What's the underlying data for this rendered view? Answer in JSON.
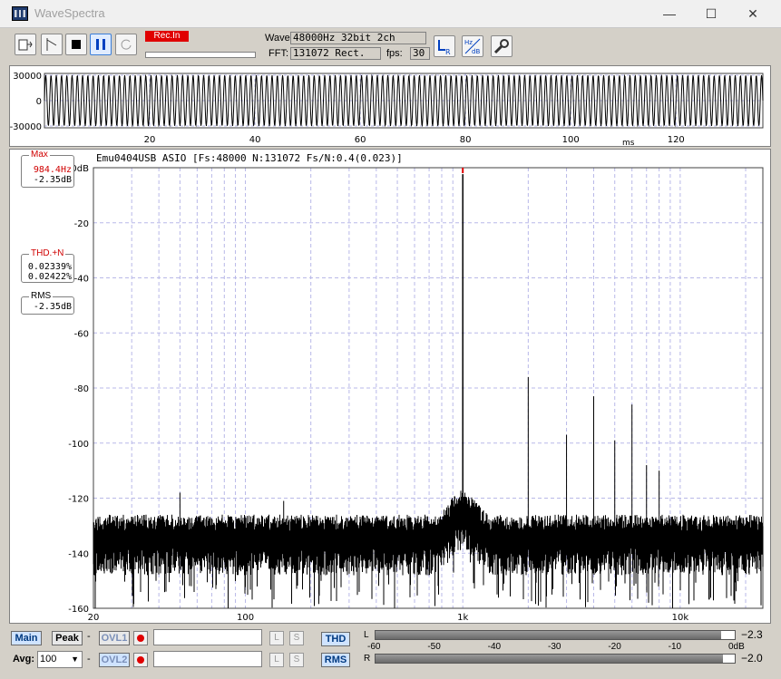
{
  "window": {
    "title": "WaveSpectra",
    "minimize": "—",
    "maximize": "☐",
    "close": "✕"
  },
  "toolbar": {
    "rec_label": "Rec.In",
    "wave_label": "Wave:",
    "wave_value": "48000Hz 32bit 2ch",
    "fft_label": "FFT:",
    "fft_value": "131072 Rect.",
    "fps_label": "fps:",
    "fps_value": "30",
    "buttons": [
      "open-file-icon",
      "marker-icon",
      "stop-icon",
      "pause-icon",
      "reload-icon",
      "lr-channel-icon",
      "hz-db-icon",
      "settings-wrench-icon"
    ]
  },
  "wave": {
    "y_ticks": [
      "30000",
      "0",
      "-30000"
    ],
    "x_ticks": [
      "20",
      "40",
      "60",
      "80",
      "100",
      "120"
    ],
    "x_unit": "ms"
  },
  "spectrum": {
    "header": "Emu0404USB ASIO  [Fs:48000 N:131072 Fs/N:0.4(0.023)]",
    "y_ticks": [
      "0dB",
      "-20",
      "-40",
      "-60",
      "-80",
      "-100",
      "-120",
      "-140",
      "-160"
    ],
    "x_ticks": [
      "20",
      "100",
      "1k",
      "10k"
    ]
  },
  "chart_data": {
    "type": "line",
    "x_scale": "log",
    "xlim": [
      20,
      24000
    ],
    "ylim": [
      -160,
      0
    ],
    "peaks": [
      {
        "x": 1000,
        "y": -2.35
      },
      {
        "x": 2000,
        "y": -76
      },
      {
        "x": 3000,
        "y": -97
      },
      {
        "x": 4000,
        "y": -83
      },
      {
        "x": 5000,
        "y": -99
      },
      {
        "x": 6000,
        "y": -86
      },
      {
        "x": 7000,
        "y": -108
      },
      {
        "x": 8000,
        "y": -110
      },
      {
        "x": 50,
        "y": -118
      },
      {
        "x": 150,
        "y": -121
      }
    ],
    "noise_floor_db": -132
  },
  "readouts": {
    "max_title": "Max",
    "max_freq": "984.4Hz",
    "max_level": "-2.35dB",
    "thd_title": "THD.+N",
    "thd_l": "0.02339%",
    "thd_r": "0.02422%",
    "rms_title": "RMS",
    "rms_value": "-2.35dB"
  },
  "bottom": {
    "main": "Main",
    "peak": "Peak",
    "dash1": "-",
    "ovl1": "OVL1",
    "avg_label": "Avg:",
    "avg_value": "100",
    "dash2": "-",
    "ovl2": "OVL2",
    "l": "L",
    "s": "S",
    "thd": "THD",
    "rms": "RMS",
    "meter_l": "L",
    "meter_r": "R",
    "meter_ticks": [
      "-60",
      "-50",
      "-40",
      "-30",
      "-20",
      "-10",
      "0dB"
    ],
    "meter_l_value": "−2.3",
    "meter_r_value": "−2.0",
    "meter_l_level": 0.962,
    "meter_r_level": 0.967
  }
}
